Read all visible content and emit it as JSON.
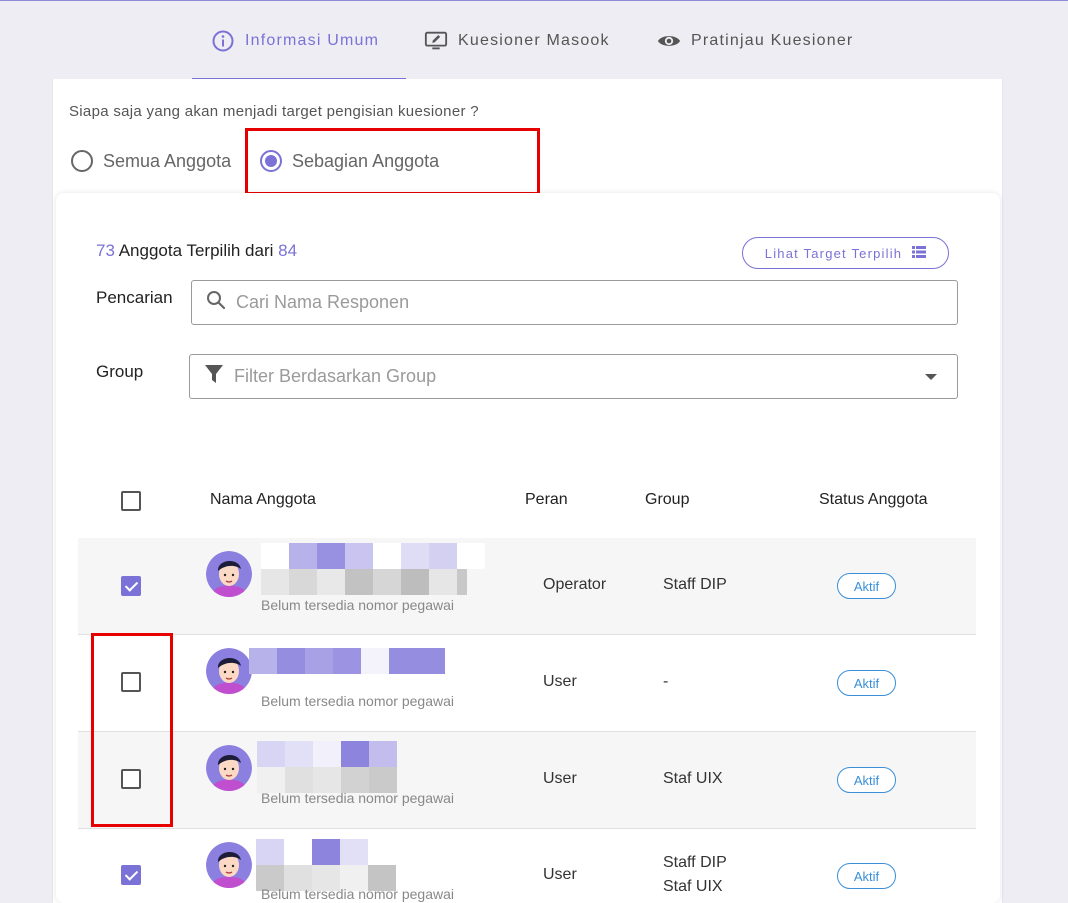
{
  "tabs": [
    {
      "label": "Informasi Umum",
      "icon": "info-icon",
      "active": true
    },
    {
      "label": "Kuesioner Masook",
      "icon": "monitor-edit-icon",
      "active": false
    },
    {
      "label": "Pratinjau Kuesioner",
      "icon": "eye-icon",
      "active": false
    }
  ],
  "colors": {
    "accent": "#7a72d6",
    "badge": "#3a8fd8",
    "highlight": "#e60000"
  },
  "target": {
    "question": "Siapa saja yang akan menjadi target pengisian kuesioner ?",
    "options": [
      {
        "label": "Semua Anggota",
        "selected": false
      },
      {
        "label": "Sebagian Anggota",
        "selected": true
      }
    ]
  },
  "selection": {
    "selected_count": "73",
    "middle_text": "Anggota Terpilih dari",
    "total": "84",
    "view_button": "Lihat Target Terpilih"
  },
  "search": {
    "label": "Pencarian",
    "placeholder": "Cari Nama Responen",
    "value": ""
  },
  "group_filter": {
    "label": "Group",
    "placeholder": "Filter Berdasarkan Group"
  },
  "table": {
    "headers": {
      "name": "Nama Anggota",
      "role": "Peran",
      "group": "Group",
      "status": "Status Anggota"
    },
    "rows": [
      {
        "checked": true,
        "subtitle": "Belum tersedia nomor pegawai",
        "role": "Operator",
        "group": "Staff DIP",
        "group2": "",
        "status": "Aktif"
      },
      {
        "checked": false,
        "subtitle": "Belum tersedia nomor pegawai",
        "role": "User",
        "group": "-",
        "group2": "",
        "status": "Aktif"
      },
      {
        "checked": false,
        "subtitle": "Belum tersedia nomor pegawai",
        "role": "User",
        "group": "Staf UIX",
        "group2": "",
        "status": "Aktif"
      },
      {
        "checked": true,
        "subtitle": "Belum tersedia nomor pegawai",
        "role": "User",
        "group": "Staff DIP",
        "group2": "Staf UIX",
        "status": "Aktif"
      }
    ]
  }
}
